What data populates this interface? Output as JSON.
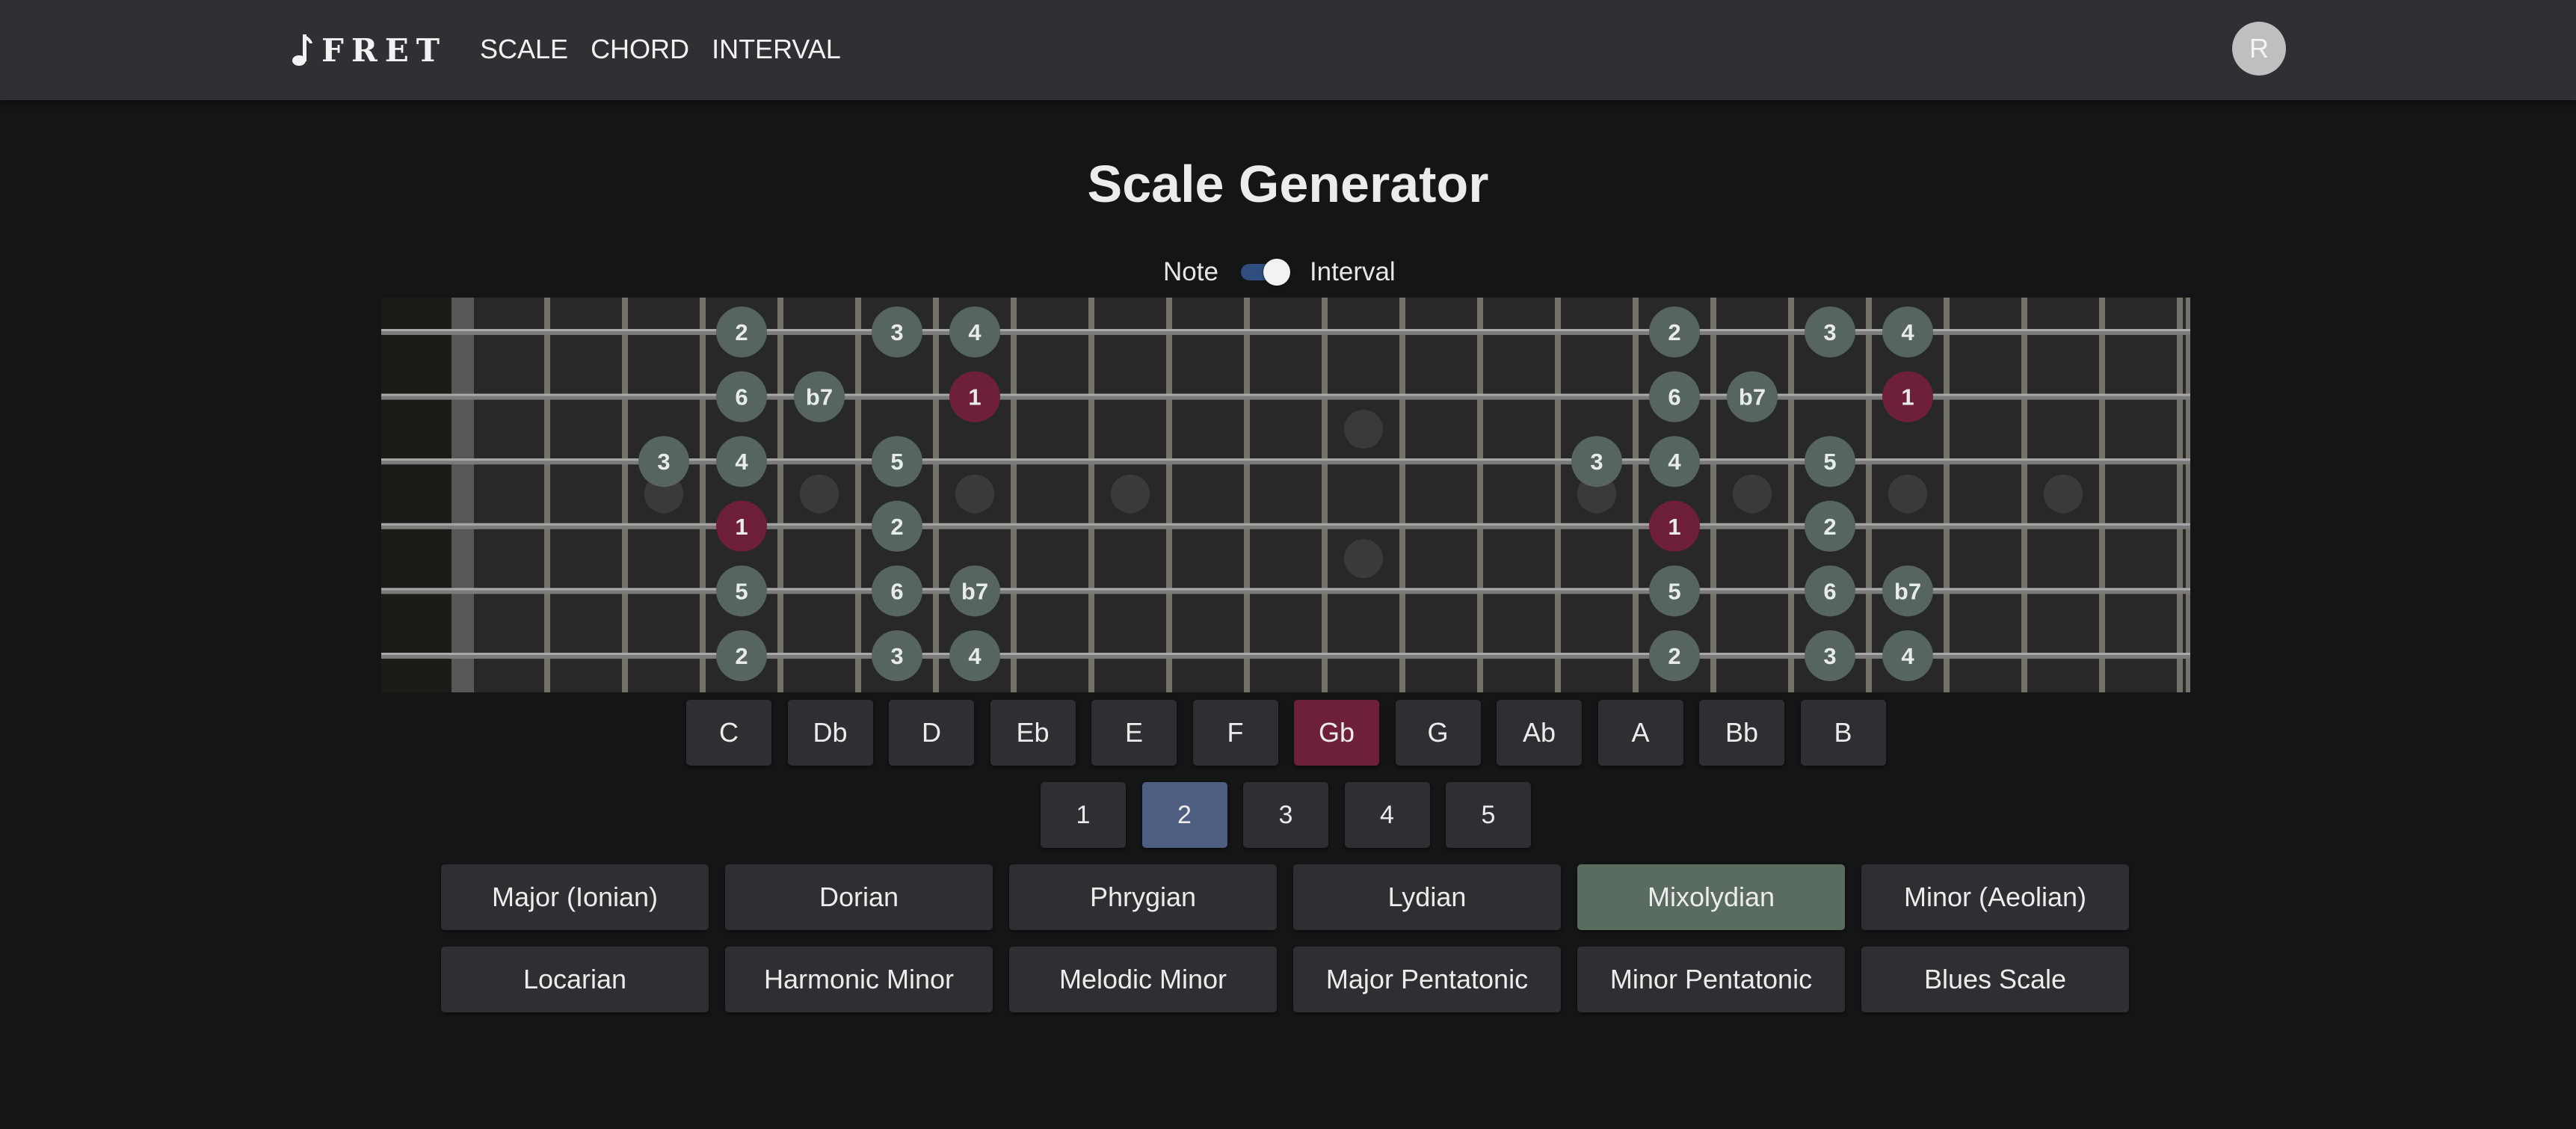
{
  "app": {
    "name": "FRET",
    "nav": [
      "SCALE",
      "CHORD",
      "INTERVAL"
    ],
    "avatar_initial": "R"
  },
  "page": {
    "title": "Scale Generator",
    "toggle": {
      "left_label": "Note",
      "right_label": "Interval",
      "state": "Interval"
    }
  },
  "fretboard": {
    "display_mode": "interval",
    "strings": 6,
    "frets": 22,
    "inlay_single_frets": [
      3,
      5,
      7,
      9,
      15,
      17,
      19,
      21
    ],
    "inlay_double_frets": [
      12
    ],
    "markers": [
      {
        "string": 1,
        "fret": 4,
        "label": "2",
        "root": false
      },
      {
        "string": 1,
        "fret": 6,
        "label": "3",
        "root": false
      },
      {
        "string": 1,
        "fret": 7,
        "label": "4",
        "root": false
      },
      {
        "string": 1,
        "fret": 16,
        "label": "2",
        "root": false
      },
      {
        "string": 1,
        "fret": 18,
        "label": "3",
        "root": false
      },
      {
        "string": 1,
        "fret": 19,
        "label": "4",
        "root": false
      },
      {
        "string": 2,
        "fret": 4,
        "label": "6",
        "root": false
      },
      {
        "string": 2,
        "fret": 5,
        "label": "b7",
        "root": false
      },
      {
        "string": 2,
        "fret": 7,
        "label": "1",
        "root": true
      },
      {
        "string": 2,
        "fret": 16,
        "label": "6",
        "root": false
      },
      {
        "string": 2,
        "fret": 17,
        "label": "b7",
        "root": false
      },
      {
        "string": 2,
        "fret": 19,
        "label": "1",
        "root": true
      },
      {
        "string": 3,
        "fret": 3,
        "label": "3",
        "root": false
      },
      {
        "string": 3,
        "fret": 4,
        "label": "4",
        "root": false
      },
      {
        "string": 3,
        "fret": 6,
        "label": "5",
        "root": false
      },
      {
        "string": 3,
        "fret": 15,
        "label": "3",
        "root": false
      },
      {
        "string": 3,
        "fret": 16,
        "label": "4",
        "root": false
      },
      {
        "string": 3,
        "fret": 18,
        "label": "5",
        "root": false
      },
      {
        "string": 4,
        "fret": 4,
        "label": "1",
        "root": true
      },
      {
        "string": 4,
        "fret": 6,
        "label": "2",
        "root": false
      },
      {
        "string": 4,
        "fret": 16,
        "label": "1",
        "root": true
      },
      {
        "string": 4,
        "fret": 18,
        "label": "2",
        "root": false
      },
      {
        "string": 5,
        "fret": 4,
        "label": "5",
        "root": false
      },
      {
        "string": 5,
        "fret": 6,
        "label": "6",
        "root": false
      },
      {
        "string": 5,
        "fret": 7,
        "label": "b7",
        "root": false
      },
      {
        "string": 5,
        "fret": 16,
        "label": "5",
        "root": false
      },
      {
        "string": 5,
        "fret": 18,
        "label": "6",
        "root": false
      },
      {
        "string": 5,
        "fret": 19,
        "label": "b7",
        "root": false
      },
      {
        "string": 6,
        "fret": 4,
        "label": "2",
        "root": false
      },
      {
        "string": 6,
        "fret": 6,
        "label": "3",
        "root": false
      },
      {
        "string": 6,
        "fret": 7,
        "label": "4",
        "root": false
      },
      {
        "string": 6,
        "fret": 16,
        "label": "2",
        "root": false
      },
      {
        "string": 6,
        "fret": 18,
        "label": "3",
        "root": false
      },
      {
        "string": 6,
        "fret": 19,
        "label": "4",
        "root": false
      }
    ]
  },
  "keys": {
    "items": [
      "C",
      "Db",
      "D",
      "Eb",
      "E",
      "F",
      "Gb",
      "G",
      "Ab",
      "A",
      "Bb",
      "B"
    ],
    "selected": "Gb"
  },
  "positions": {
    "items": [
      "1",
      "2",
      "3",
      "4",
      "5"
    ],
    "selected": "2"
  },
  "scales": {
    "items": [
      "Major (Ionian)",
      "Dorian",
      "Phrygian",
      "Lydian",
      "Mixolydian",
      "Minor (Aeolian)",
      "Locarian",
      "Harmonic Minor",
      "Melodic Minor",
      "Major Pentatonic",
      "Minor Pentatonic",
      "Blues Scale"
    ],
    "selected": "Mixolydian"
  },
  "colors": {
    "root_marker": "#6e1f3b",
    "interval_marker": "#56655d",
    "selected_key": "#6e1f3b",
    "selected_position": "#4e5e80",
    "selected_scale": "#5a6c60",
    "toggle_track": "#2f4d7e"
  }
}
